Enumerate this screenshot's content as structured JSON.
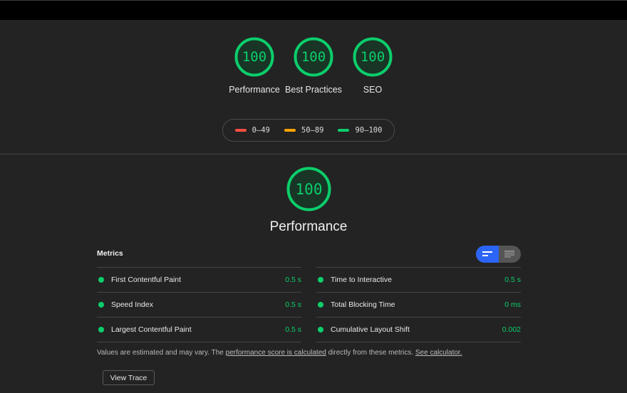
{
  "gauges": [
    {
      "score": "100",
      "label": "Performance"
    },
    {
      "score": "100",
      "label": "Best Practices"
    },
    {
      "score": "100",
      "label": "SEO"
    }
  ],
  "legend": [
    {
      "range": "0–49",
      "color": "#ff4e42"
    },
    {
      "range": "50–89",
      "color": "#ffa400"
    },
    {
      "range": "90–100",
      "color": "#0cce6b"
    }
  ],
  "performance": {
    "score": "100",
    "title": "Performance"
  },
  "metrics": {
    "header": "Metrics",
    "left": [
      {
        "name": "First Contentful Paint",
        "value": "0.5 s"
      },
      {
        "name": "Speed Index",
        "value": "0.5 s"
      },
      {
        "name": "Largest Contentful Paint",
        "value": "0.5 s"
      }
    ],
    "right": [
      {
        "name": "Time to Interactive",
        "value": "0.5 s"
      },
      {
        "name": "Total Blocking Time",
        "value": "0 ms"
      },
      {
        "name": "Cumulative Layout Shift",
        "value": "0.002"
      }
    ]
  },
  "note": {
    "text1": "Values are estimated and may vary. The ",
    "link1": "performance score is calculated",
    "text2": " directly from these metrics. ",
    "link2": "See calculator."
  },
  "view_trace_label": "View Trace",
  "colors": {
    "pass": "#0cce6b",
    "toggle_active": "#2b65f5"
  }
}
